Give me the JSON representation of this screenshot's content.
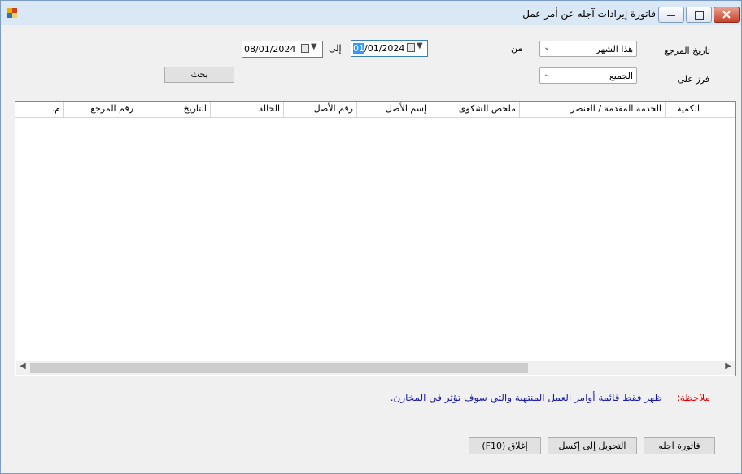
{
  "window": {
    "title": "فاتورة إيرادات آجله عن أمر عمل"
  },
  "filters": {
    "ref_date_label": "تاريخ المرجع",
    "from_label": "من",
    "to_label": "إلى",
    "period_value": "هذا الشهر",
    "from_date_selected": "01",
    "from_date_rest": "/01/2024",
    "to_date": "08/01/2024",
    "sort_label": "فرز على",
    "sort_value": "الجميع",
    "search_label": "بحث"
  },
  "grid": {
    "columns": [
      "الكمية",
      "الخدمة المقدمة / العنصر",
      "ملخص الشكوى",
      "إسم الأصل",
      "رقم الأصل",
      "الحالة",
      "التاريخ",
      "رقم المرجع",
      "م."
    ],
    "rows": []
  },
  "note": {
    "label": "ملاحظة:",
    "text": "ظهر فقط قائمة أوامر العمل المنتهية والتي سوف تؤثر في المخازن."
  },
  "buttons": {
    "invoice": "فاتورة آجله",
    "export": "التحويل إلى إكسل",
    "close": "إغلاق (F10)"
  }
}
